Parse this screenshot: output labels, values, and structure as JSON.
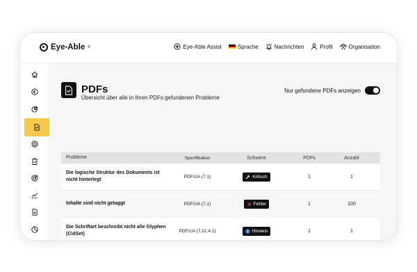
{
  "brand": {
    "name": "Eye-Able",
    "mark": "®"
  },
  "nav": [
    {
      "label": "Eye-Able Assist",
      "icon": "eye-able-icon"
    },
    {
      "label": "Sprache",
      "icon": "german-flag-icon"
    },
    {
      "label": "Nachrichten",
      "icon": "bell-icon"
    },
    {
      "label": "Profil",
      "icon": "user-icon"
    },
    {
      "label": "Organisation",
      "icon": "team-icon"
    }
  ],
  "sidebar": [
    {
      "icon": "home-icon",
      "active": false
    },
    {
      "icon": "euro-icon",
      "active": false
    },
    {
      "icon": "pie-chart-icon",
      "active": false
    },
    {
      "icon": "pdf-icon",
      "active": true
    },
    {
      "icon": "radar-icon",
      "active": false
    },
    {
      "icon": "clipboard-icon",
      "active": false
    },
    {
      "icon": "target-icon",
      "active": false
    },
    {
      "icon": "trend-line-icon",
      "active": false
    },
    {
      "icon": "document-icon",
      "active": false
    },
    {
      "icon": "report-chart-icon",
      "active": false
    }
  ],
  "page": {
    "title": "PDFs",
    "subtitle": "Übersicht über alle in Ihren PDFs gefundenen Probleme",
    "toggle_label": "Nur gefundene PDFs anzeigen",
    "toggle_on": true
  },
  "table": {
    "headers": [
      "Probleme",
      "Spezifikation",
      "Schwere",
      "PDFs",
      "Anzahl"
    ],
    "rows": [
      {
        "problem": "Die logische Struktur des Dokuments ist nicht hinterlegt",
        "spec": "PDF/UA (7.1)",
        "severity": "Kritisch",
        "severity_icon": "wrench-icon",
        "pdfs": "1",
        "count": "1"
      },
      {
        "problem": "Inhalte sind nicht getaggt",
        "spec": "PDF/UA (7.1)",
        "severity": "Fehler",
        "severity_icon": "x-icon",
        "pdfs": "1",
        "count": "100"
      },
      {
        "problem": "Die Schriftart beschreibt nicht alle Glyphen (CidSet)",
        "spec": "PDF/UA (7.21.4.2)",
        "severity": "Hinweis",
        "severity_icon": "info-icon",
        "pdfs": "1",
        "count": "1"
      }
    ]
  },
  "colors": {
    "accent": "#f7c84a",
    "dark": "#111111",
    "error": "#e53935",
    "info": "#2f80ed",
    "flag_black": "#000000",
    "flag_red": "#dd0000",
    "flag_gold": "#ffce00"
  }
}
